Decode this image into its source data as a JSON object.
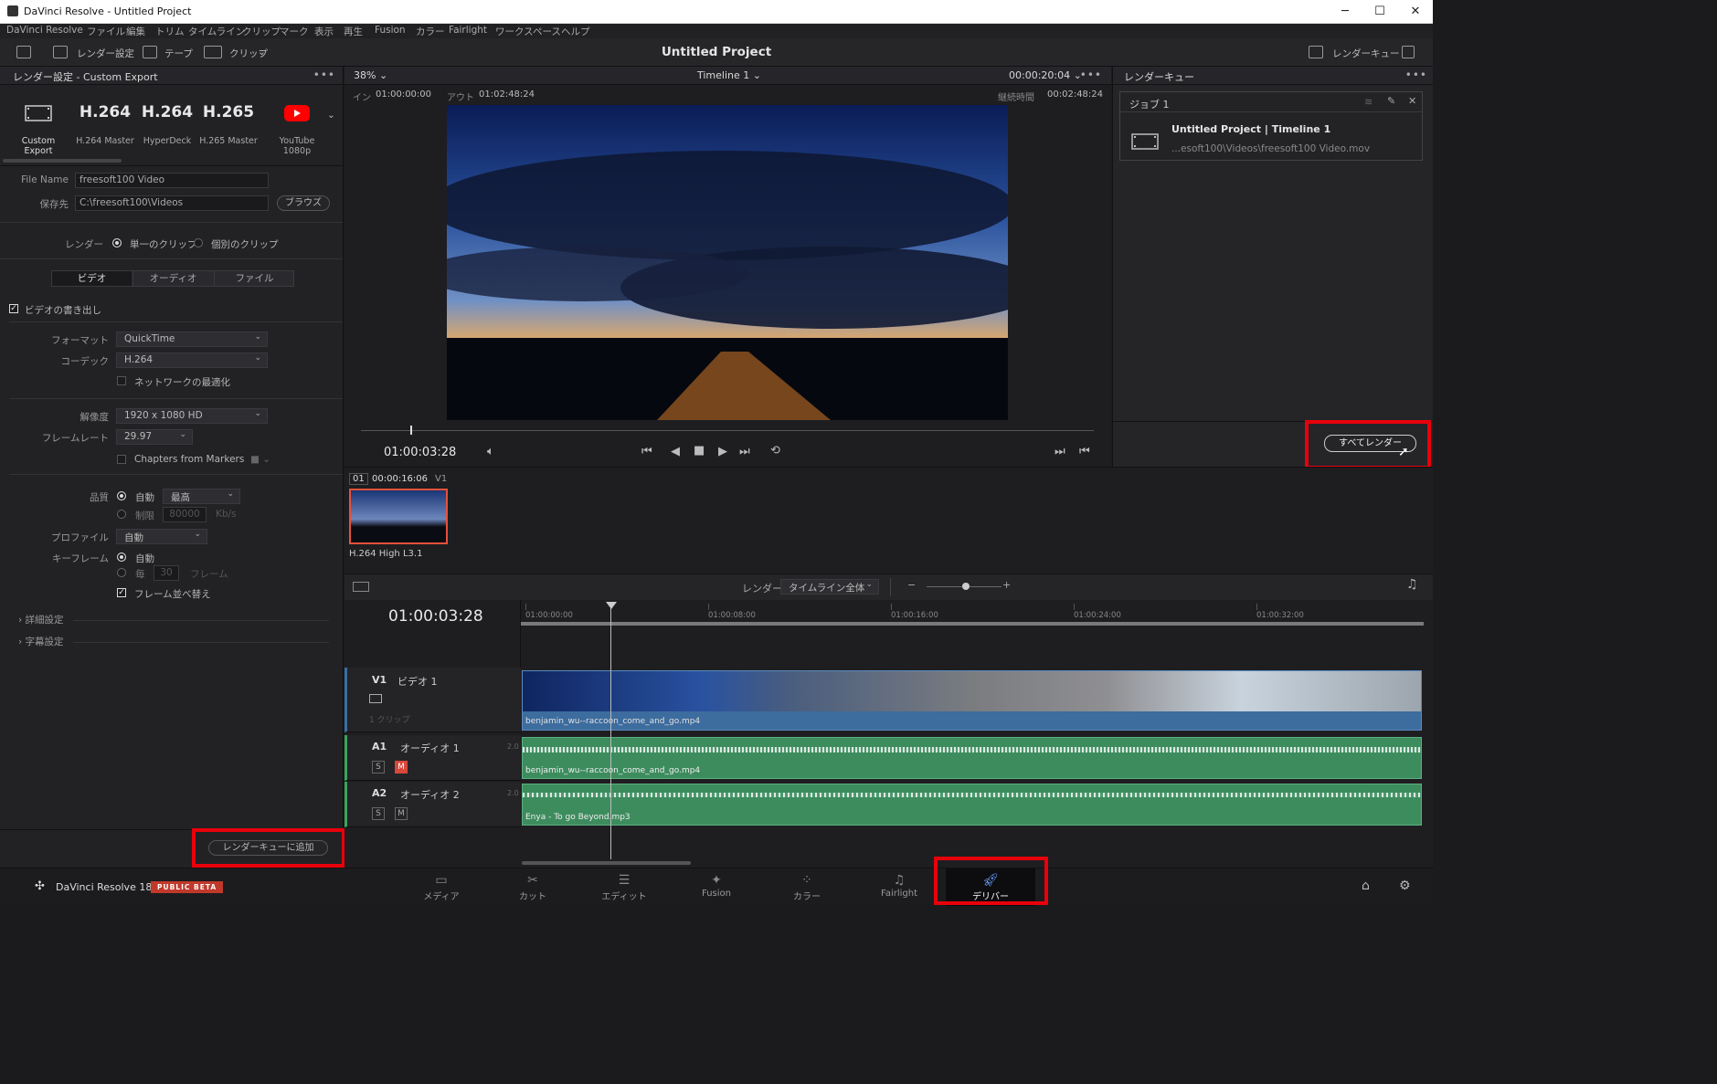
{
  "window": {
    "title": "DaVinci Resolve - Untitled Project",
    "minimize": "─",
    "maximize": "☐",
    "close": "✕"
  },
  "menu": [
    "DaVinci Resolve",
    "ファイル",
    "編集",
    "トリム",
    "タイムライン",
    "クリップ",
    "マーク",
    "表示",
    "再生",
    "Fusion",
    "カラー",
    "Fairlight",
    "ワークスペース",
    "ヘルプ"
  ],
  "toolbar": {
    "render_settings": "レンダー設定",
    "tape": "テープ",
    "clip": "クリップ",
    "project_title": "Untitled Project",
    "render_queue": "レンダーキュー"
  },
  "render_settings": {
    "header": "レンダー設定 - Custom Export",
    "presets": [
      {
        "big": "",
        "sub": "Custom Export"
      },
      {
        "big": "H.264",
        "sub": "H.264 Master"
      },
      {
        "big": "H.264",
        "sub": "HyperDeck"
      },
      {
        "big": "H.265",
        "sub": "H.265 Master"
      },
      {
        "big": "",
        "sub": "YouTube 1080p"
      }
    ],
    "file_name_label": "File Name",
    "file_name": "freesoft100 Video",
    "location_label": "保存先",
    "location": "C:\\freesoft100\\Videos",
    "browse": "ブラウズ",
    "render_label": "レンダー",
    "single_clip": "単一のクリップ",
    "individual_clips": "個別のクリップ",
    "tabs": [
      "ビデオ",
      "オーディオ",
      "ファイル"
    ],
    "export_video": "ビデオの書き出し",
    "format_label": "フォーマット",
    "format": "QuickTime",
    "codec_label": "コーデック",
    "codec": "H.264",
    "network_opt": "ネットワークの最適化",
    "resolution_label": "解像度",
    "resolution": "1920 x 1080 HD",
    "framerate_label": "フレームレート",
    "framerate": "29.97",
    "chapters": "Chapters from Markers",
    "quality_label": "品質",
    "auto": "自動",
    "quality": "最高",
    "limit": "制限",
    "limit_value": "80000",
    "kbs": "Kb/s",
    "profile_label": "プロファイル",
    "profile": "自動",
    "keyframe_label": "キーフレーム",
    "kf_auto": "自動",
    "kf_every": "毎",
    "kf_value": "30",
    "kf_unit": "フレーム",
    "frame_reorder": "フレーム並べ替え",
    "advanced": "詳細設定",
    "subtitles": "字幕設定",
    "add_to_queue": "レンダーキューに追加"
  },
  "viewer": {
    "zoom": "38%",
    "timeline_name": "Timeline 1",
    "timecode": "00:00:20:04",
    "in_label": "イン",
    "in_tc": "01:00:00:00",
    "out_label": "アウト",
    "out_tc": "01:02:48:24",
    "duration_label": "継続時間",
    "duration_tc": "00:02:48:24",
    "current_tc": "01:00:03:28"
  },
  "queue": {
    "header": "レンダーキュー",
    "job_title": "ジョブ 1",
    "job_name": "Untitled Project | Timeline 1",
    "job_path": "...esoft100\\Videos\\freesoft100 Video.mov",
    "render_all": "すべてレンダー"
  },
  "clip": {
    "index": "01",
    "tc": "00:00:16:06",
    "track": "V1",
    "codec": "H.264 High L3.1"
  },
  "timeline_bar": {
    "render_label": "レンダー",
    "render_range": "タイムライン全体"
  },
  "timeline": {
    "timecode": "01:00:03:28",
    "ruler": [
      "01:00:00:00",
      "01:00:08:00",
      "01:00:16:00",
      "01:00:24:00",
      "01:00:32:00"
    ],
    "tracks": [
      {
        "id": "V1",
        "name": "ビデオ 1",
        "sub": "1 クリップ",
        "clip": "benjamin_wu--raccoon_come_and_go.mp4"
      },
      {
        "id": "A1",
        "name": "オーディオ 1",
        "ch": "2.0",
        "clip": "benjamin_wu--raccoon_come_and_go.mp4"
      },
      {
        "id": "A2",
        "name": "オーディオ 2",
        "ch": "2.0",
        "clip": "Enya - To go Beyond.mp3"
      }
    ],
    "solo": "S",
    "mute": "M"
  },
  "footer": {
    "app": "DaVinci Resolve 18",
    "badge": "PUBLIC BETA",
    "pages": [
      "メディア",
      "カット",
      "エディット",
      "Fusion",
      "カラー",
      "Fairlight",
      "デリバー"
    ]
  }
}
